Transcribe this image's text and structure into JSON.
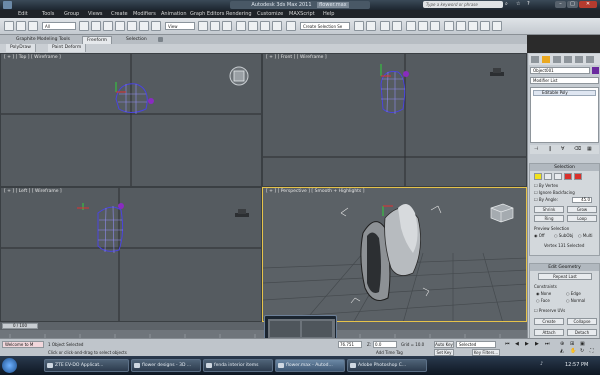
{
  "titlebar": {
    "title": "Autodesk 3ds Max 2011",
    "filename": "flower.max",
    "search_placeholder": "Type a keyword or phrase"
  },
  "menu": [
    "Edit",
    "Tools",
    "Group",
    "Views",
    "Create",
    "Modifiers",
    "Animation",
    "Graph Editors",
    "Rendering",
    "Customize",
    "MAXScript",
    "Help"
  ],
  "toolbar": {
    "filter": "All",
    "view": "View",
    "selection_set": "Create Selection Se"
  },
  "ribbon": {
    "tabs": [
      "Graphite Modeling Tools",
      "Freeform",
      "Selection"
    ],
    "active_tab": "Freeform",
    "subtabs": [
      "PolyDraw",
      "Paint Deform"
    ]
  },
  "viewports": {
    "top": "[ + ] [ Top ] [ Wireframe ]",
    "front": "[ + ] [ Front ] [ Wireframe ]",
    "left": "[ + ] [ Left ] [ Wireframe ]",
    "persp": "[ + ] [ Perspective ] [ Smooth + Highlights ]"
  },
  "command_panel": {
    "object_name": "Object001",
    "modifier_list": "Modifier List",
    "stack_item": "Editable Poly",
    "selection": {
      "header": "Selection",
      "by_vertex": "By Vertex",
      "ignore_backfacing": "Ignore Backfacing",
      "by_angle": "By Angle:",
      "angle_value": "45.0",
      "shrink": "Shrink",
      "grow": "Grow",
      "ring": "Ring",
      "loop": "Loop",
      "preview": "Preview Selection",
      "off": "Off",
      "subobj": "SubObj",
      "multi": "Multi",
      "status": "Vertex 131 Selected"
    },
    "edit_geometry": {
      "header": "Edit Geometry",
      "repeat_last": "Repeat Last",
      "constraints": "Constraints",
      "none": "None",
      "edge": "Edge",
      "face": "Face",
      "normal": "Normal",
      "preserve_uvs": "Preserve UVs",
      "create": "Create",
      "collapse": "Collapse",
      "attach": "Attach",
      "detach": "Detach"
    }
  },
  "timeline": {
    "frame": "0 / 100"
  },
  "status": {
    "selected": "1 Object Selected",
    "prompt": "Click or click-and-drag to select objects",
    "maxscript": "Welcome to M",
    "x_value": "76.751",
    "z_label": "Z:",
    "z_value": "0.0",
    "grid": "Grid = 10.0",
    "auto_key": "Auto Key",
    "selected_dropdown": "Selected",
    "set_key": "Set Key",
    "key_filters": "Key Filters...",
    "add_time_tag": "Add Time Tag"
  },
  "taskbar": {
    "items": [
      "ZTE EV-DO Applicat...",
      "flower designs - 3D ...",
      "fenda interior items",
      "flower.max - Autod...",
      "Adobe Photoshop C..."
    ],
    "active_index": 3,
    "clock": "12:57 PM"
  },
  "colors": {
    "viewport_bg": "#555b60",
    "active_border": "#e6c34a",
    "mesh_wire": "#4a44e0",
    "gizmo_purple": "#8a2bc0"
  }
}
